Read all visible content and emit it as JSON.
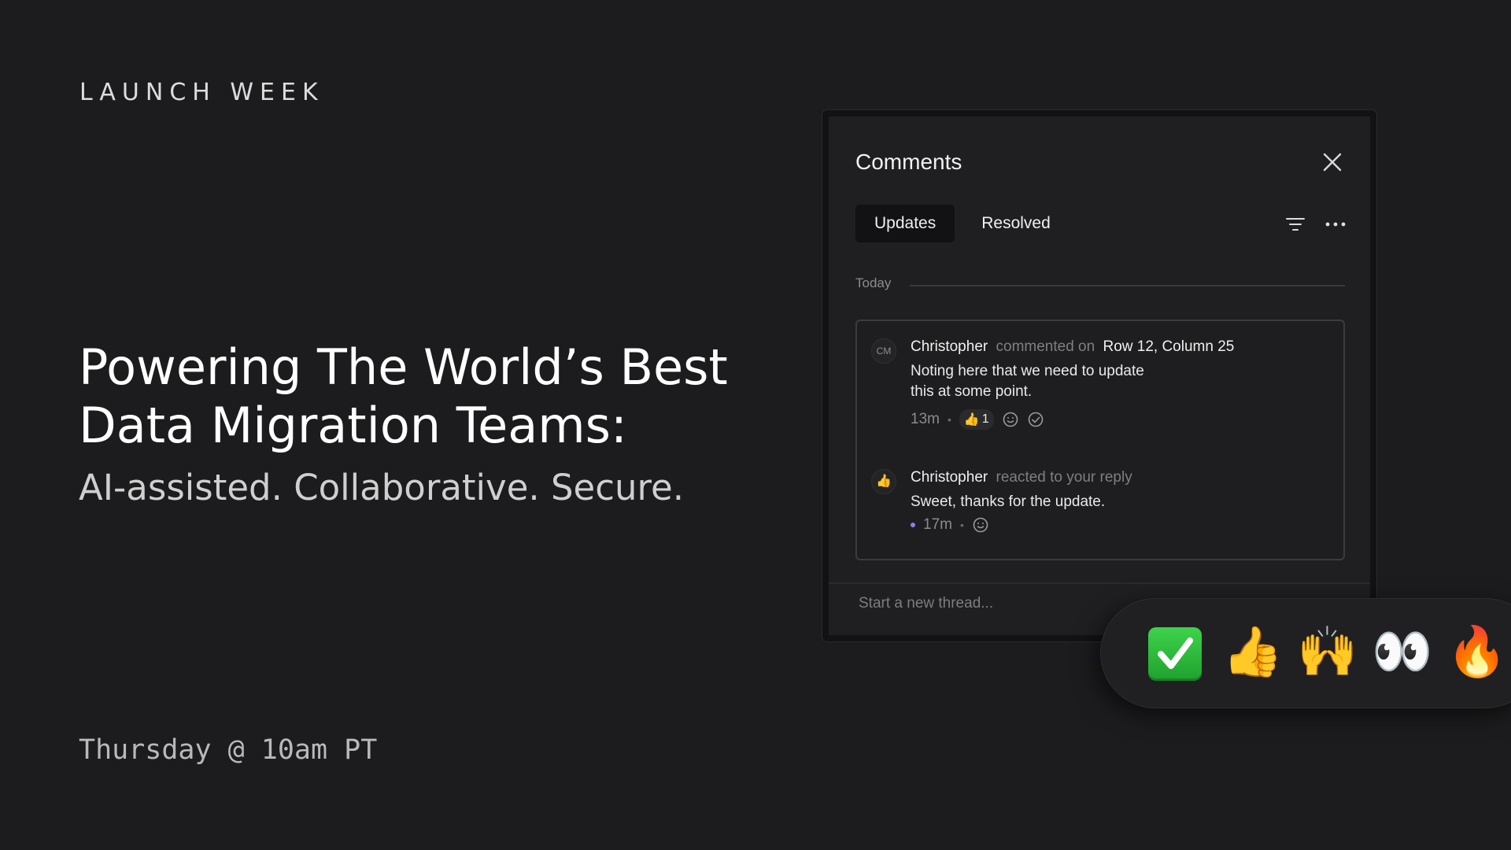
{
  "promo": {
    "eyebrow": "LAUNCH WEEK",
    "headline_line1": "Powering The World’s Best",
    "headline_line2": "Data Migration Teams:",
    "subhead": "AI-assisted. Collaborative. Secure.",
    "date": "Thursday @ 10am PT"
  },
  "panel": {
    "title": "Comments",
    "tabs": [
      {
        "label": "Updates",
        "active": true
      },
      {
        "label": "Resolved",
        "active": false
      }
    ],
    "section_label": "Today",
    "comments": [
      {
        "avatar": "CM",
        "author": "Christopher",
        "action": "commented on",
        "target": "Row 12, Column 25",
        "body_line1": "Noting here that we need to update",
        "body_line2": "this at some point.",
        "time": "13m",
        "reaction_emoji": "👍",
        "reaction_count": "1"
      },
      {
        "avatar": "👍",
        "author": "Christopher",
        "action": "reacted to your reply",
        "body": "Sweet, thanks for the update.",
        "time": "17m"
      }
    ],
    "composer_placeholder": "Start a new thread..."
  },
  "emoji_bar": {
    "items": [
      "✅",
      "👍",
      "🙌",
      "👀",
      "🔥"
    ]
  },
  "colors": {
    "background": "#1c1c1e",
    "panel": "#1f1f21",
    "unread": "#8c7ff2"
  }
}
